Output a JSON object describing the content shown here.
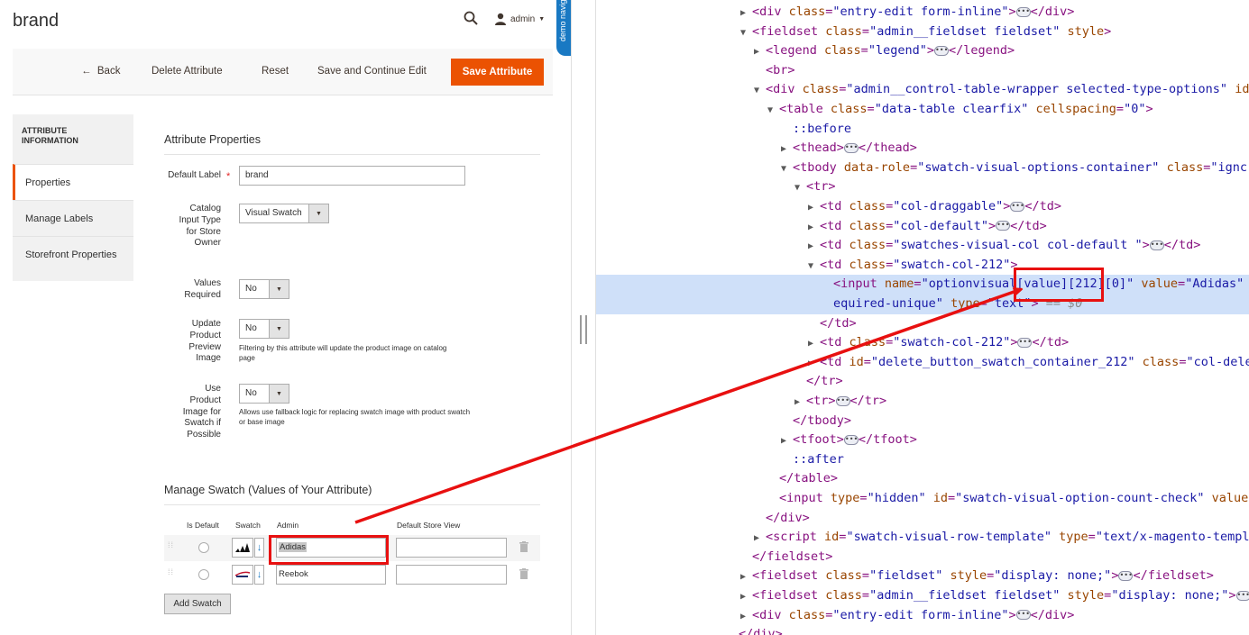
{
  "header": {
    "page_title": "brand",
    "user_label": "admin",
    "demo_tab": "demo navig"
  },
  "actions": {
    "back": "Back",
    "delete": "Delete Attribute",
    "reset": "Reset",
    "save_continue": "Save and Continue Edit",
    "save": "Save Attribute"
  },
  "sidebar": {
    "heading": "ATTRIBUTE INFORMATION",
    "items": [
      {
        "label": "Properties",
        "active": true
      },
      {
        "label": "Manage Labels",
        "active": false
      },
      {
        "label": "Storefront Properties",
        "active": false
      }
    ]
  },
  "properties": {
    "title": "Attribute Properties",
    "default_label": {
      "label": "Default Label",
      "value": "brand"
    },
    "input_type": {
      "label": "Catalog Input Type for Store Owner",
      "value": "Visual Swatch"
    },
    "values_required": {
      "label": "Values Required",
      "value": "No"
    },
    "update_preview": {
      "label": "Update Product Preview Image",
      "value": "No",
      "note": "Filtering by this attribute will update the product image on catalog page"
    },
    "use_product_image": {
      "label": "Use Product Image for Swatch if Possible",
      "value": "No",
      "note": "Allows use fallback logic for replacing swatch image with product swatch or base image"
    }
  },
  "swatch": {
    "title": "Manage Swatch (Values of Your Attribute)",
    "columns": [
      "Is Default",
      "Swatch",
      "Admin",
      "Default Store View"
    ],
    "rows": [
      {
        "admin": "Adidas",
        "store_view": ""
      },
      {
        "admin": "Reebok",
        "store_view": ""
      }
    ],
    "add_button": "Add Swatch"
  },
  "devtools": {
    "lines": [
      {
        "indent": 0,
        "toggle": "▶",
        "parts": [
          [
            "tg",
            "<div "
          ],
          [
            "at",
            "class"
          ],
          [
            "tg",
            "="
          ],
          [
            "av",
            "\"entry-edit form-inline\""
          ],
          [
            "tg",
            ">"
          ],
          [
            "ell",
            ""
          ],
          [
            "tg",
            "</div>"
          ]
        ]
      },
      {
        "indent": 0,
        "toggle": "▼",
        "parts": [
          [
            "tg",
            "<fieldset "
          ],
          [
            "at",
            "class"
          ],
          [
            "tg",
            "="
          ],
          [
            "av",
            "\"admin__fieldset fieldset\""
          ],
          [
            "tg",
            " "
          ],
          [
            "at",
            "style"
          ],
          [
            "tg",
            ">"
          ]
        ]
      },
      {
        "indent": 1,
        "toggle": "▶",
        "parts": [
          [
            "tg",
            "<legend "
          ],
          [
            "at",
            "class"
          ],
          [
            "tg",
            "="
          ],
          [
            "av",
            "\"legend\""
          ],
          [
            "tg",
            ">"
          ],
          [
            "ell",
            ""
          ],
          [
            "tg",
            "</legend>"
          ]
        ]
      },
      {
        "indent": 1,
        "toggle": "",
        "parts": [
          [
            "tg",
            "<br>"
          ]
        ]
      },
      {
        "indent": 1,
        "toggle": "▼",
        "parts": [
          [
            "tg",
            "<div "
          ],
          [
            "at",
            "class"
          ],
          [
            "tg",
            "="
          ],
          [
            "av",
            "\"admin__control-table-wrapper selected-type-options\""
          ],
          [
            "tg",
            " "
          ],
          [
            "at",
            "id"
          ]
        ]
      },
      {
        "indent": 2,
        "toggle": "▼",
        "parts": [
          [
            "tg",
            "<table "
          ],
          [
            "at",
            "class"
          ],
          [
            "tg",
            "="
          ],
          [
            "av",
            "\"data-table clearfix\""
          ],
          [
            "tg",
            " "
          ],
          [
            "at",
            "cellspacing"
          ],
          [
            "tg",
            "="
          ],
          [
            "av",
            "\"0\""
          ],
          [
            "tg",
            ">"
          ]
        ]
      },
      {
        "indent": 3,
        "toggle": "",
        "parts": [
          [
            "ps",
            "::before"
          ]
        ]
      },
      {
        "indent": 3,
        "toggle": "▶",
        "parts": [
          [
            "tg",
            "<thead>"
          ],
          [
            "ell",
            ""
          ],
          [
            "tg",
            "</thead>"
          ]
        ]
      },
      {
        "indent": 3,
        "toggle": "▼",
        "parts": [
          [
            "tg",
            "<tbody "
          ],
          [
            "at",
            "data-role"
          ],
          [
            "tg",
            "="
          ],
          [
            "av",
            "\"swatch-visual-options-container\""
          ],
          [
            "tg",
            " "
          ],
          [
            "at",
            "class"
          ],
          [
            "tg",
            "="
          ],
          [
            "av",
            "\"ignc"
          ]
        ]
      },
      {
        "indent": 4,
        "toggle": "▼",
        "parts": [
          [
            "tg",
            "<tr>"
          ]
        ]
      },
      {
        "indent": 5,
        "toggle": "▶",
        "parts": [
          [
            "tg",
            "<td "
          ],
          [
            "at",
            "class"
          ],
          [
            "tg",
            "="
          ],
          [
            "av",
            "\"col-draggable\""
          ],
          [
            "tg",
            ">"
          ],
          [
            "ell",
            ""
          ],
          [
            "tg",
            "</td>"
          ]
        ]
      },
      {
        "indent": 5,
        "toggle": "▶",
        "parts": [
          [
            "tg",
            "<td "
          ],
          [
            "at",
            "class"
          ],
          [
            "tg",
            "="
          ],
          [
            "av",
            "\"col-default\""
          ],
          [
            "tg",
            ">"
          ],
          [
            "ell",
            ""
          ],
          [
            "tg",
            "</td>"
          ]
        ]
      },
      {
        "indent": 5,
        "toggle": "▶",
        "parts": [
          [
            "tg",
            "<td "
          ],
          [
            "at",
            "class"
          ],
          [
            "tg",
            "="
          ],
          [
            "av",
            "\"swatches-visual-col col-default \""
          ],
          [
            "tg",
            ">"
          ],
          [
            "ell",
            ""
          ],
          [
            "tg",
            "</td>"
          ]
        ]
      },
      {
        "indent": 5,
        "toggle": "▼",
        "parts": [
          [
            "tg",
            "<td "
          ],
          [
            "at",
            "class"
          ],
          [
            "tg",
            "="
          ],
          [
            "av",
            "\"swatch-col-212\""
          ],
          [
            "tg",
            ">"
          ]
        ]
      },
      {
        "indent": 6,
        "toggle": "",
        "selected": true,
        "parts": [
          [
            "tg",
            "<input "
          ],
          [
            "at",
            "name"
          ],
          [
            "tg",
            "="
          ],
          [
            "av",
            "\"optionvisual[value][212][0]\""
          ],
          [
            "tg",
            " "
          ],
          [
            "at",
            "value"
          ],
          [
            "tg",
            "="
          ],
          [
            "av",
            "\"Adidas\" "
          ]
        ]
      },
      {
        "indent": 6,
        "toggle": "",
        "selected": true,
        "parts": [
          [
            "av",
            "equired-unique\""
          ],
          [
            "tg",
            " "
          ],
          [
            "at",
            "type"
          ],
          [
            "tg",
            "="
          ],
          [
            "av",
            "\"text\""
          ],
          [
            "tg",
            "> "
          ],
          [
            "gray",
            "== $0"
          ]
        ]
      },
      {
        "indent": 5,
        "toggle": "",
        "parts": [
          [
            "tg",
            "</td>"
          ]
        ]
      },
      {
        "indent": 5,
        "toggle": "▶",
        "parts": [
          [
            "tg",
            "<td "
          ],
          [
            "at",
            "class"
          ],
          [
            "tg",
            "="
          ],
          [
            "av",
            "\"swatch-col-212\""
          ],
          [
            "tg",
            ">"
          ],
          [
            "ell",
            ""
          ],
          [
            "tg",
            "</td>"
          ]
        ]
      },
      {
        "indent": 5,
        "toggle": "▶",
        "parts": [
          [
            "tg",
            "<td "
          ],
          [
            "at",
            "id"
          ],
          [
            "tg",
            "="
          ],
          [
            "av",
            "\"delete_button_swatch_container_212\""
          ],
          [
            "tg",
            " "
          ],
          [
            "at",
            "class"
          ],
          [
            "tg",
            "="
          ],
          [
            "av",
            "\"col-dele"
          ]
        ]
      },
      {
        "indent": 4,
        "toggle": "",
        "parts": [
          [
            "tg",
            "</tr>"
          ]
        ]
      },
      {
        "indent": 4,
        "toggle": "▶",
        "parts": [
          [
            "tg",
            "<tr>"
          ],
          [
            "ell",
            ""
          ],
          [
            "tg",
            "</tr>"
          ]
        ]
      },
      {
        "indent": 3,
        "toggle": "",
        "parts": [
          [
            "tg",
            "</tbody>"
          ]
        ]
      },
      {
        "indent": 3,
        "toggle": "▶",
        "parts": [
          [
            "tg",
            "<tfoot>"
          ],
          [
            "ell",
            ""
          ],
          [
            "tg",
            "</tfoot>"
          ]
        ]
      },
      {
        "indent": 3,
        "toggle": "",
        "parts": [
          [
            "ps",
            "::after"
          ]
        ]
      },
      {
        "indent": 2,
        "toggle": "",
        "parts": [
          [
            "tg",
            "</table>"
          ]
        ]
      },
      {
        "indent": 2,
        "toggle": "",
        "parts": [
          [
            "tg",
            "<input "
          ],
          [
            "at",
            "type"
          ],
          [
            "tg",
            "="
          ],
          [
            "av",
            "\"hidden\""
          ],
          [
            "tg",
            " "
          ],
          [
            "at",
            "id"
          ],
          [
            "tg",
            "="
          ],
          [
            "av",
            "\"swatch-visual-option-count-check\""
          ],
          [
            "tg",
            " "
          ],
          [
            "at",
            "value"
          ]
        ]
      },
      {
        "indent": 1,
        "toggle": "",
        "parts": [
          [
            "tg",
            "</div>"
          ]
        ]
      },
      {
        "indent": 1,
        "toggle": "▶",
        "parts": [
          [
            "tg",
            "<script "
          ],
          [
            "at",
            "id"
          ],
          [
            "tg",
            "="
          ],
          [
            "av",
            "\"swatch-visual-row-template\""
          ],
          [
            "tg",
            " "
          ],
          [
            "at",
            "type"
          ],
          [
            "tg",
            "="
          ],
          [
            "av",
            "\"text/x-magento-templ"
          ]
        ]
      },
      {
        "indent": 0,
        "toggle": "",
        "parts": [
          [
            "tg",
            "</fieldset>"
          ]
        ]
      },
      {
        "indent": 0,
        "toggle": "▶",
        "parts": [
          [
            "tg",
            "<fieldset "
          ],
          [
            "at",
            "class"
          ],
          [
            "tg",
            "="
          ],
          [
            "av",
            "\"fieldset\""
          ],
          [
            "tg",
            " "
          ],
          [
            "at",
            "style"
          ],
          [
            "tg",
            "="
          ],
          [
            "av",
            "\"display: none;\""
          ],
          [
            "tg",
            ">"
          ],
          [
            "ell",
            ""
          ],
          [
            "tg",
            "</fieldset>"
          ]
        ]
      },
      {
        "indent": 0,
        "toggle": "▶",
        "parts": [
          [
            "tg",
            "<fieldset "
          ],
          [
            "at",
            "class"
          ],
          [
            "tg",
            "="
          ],
          [
            "av",
            "\"admin__fieldset fieldset\""
          ],
          [
            "tg",
            " "
          ],
          [
            "at",
            "style"
          ],
          [
            "tg",
            "="
          ],
          [
            "av",
            "\"display: none;\""
          ],
          [
            "tg",
            ">"
          ],
          [
            "ell",
            ""
          ]
        ]
      },
      {
        "indent": 0,
        "toggle": "▶",
        "parts": [
          [
            "tg",
            "<div "
          ],
          [
            "at",
            "class"
          ],
          [
            "tg",
            "="
          ],
          [
            "av",
            "\"entry-edit form-inline\""
          ],
          [
            "tg",
            ">"
          ],
          [
            "ell",
            ""
          ],
          [
            "tg",
            "</div>"
          ]
        ]
      },
      {
        "indent": -1,
        "toggle": "",
        "parts": [
          [
            "tg",
            "</div>"
          ]
        ]
      }
    ]
  },
  "colors": {
    "accent": "#eb5202",
    "highlight_box": "#e81010",
    "devtools_selection": "#cfe0f9"
  }
}
